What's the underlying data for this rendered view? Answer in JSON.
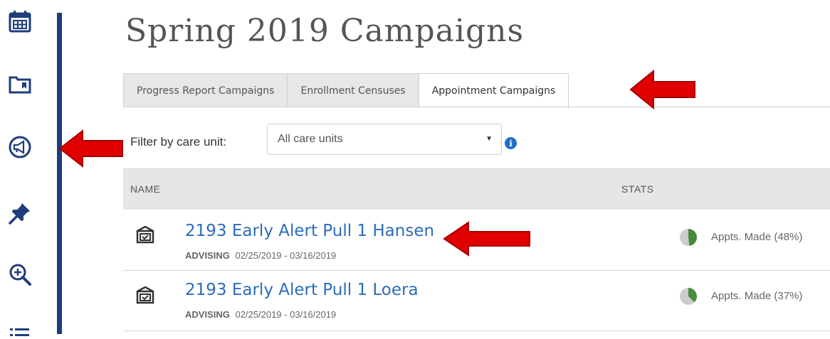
{
  "page": {
    "title": "Spring 2019 Campaigns"
  },
  "tabs": [
    {
      "label": "Progress Report Campaigns",
      "active": false
    },
    {
      "label": "Enrollment Censuses",
      "active": false
    },
    {
      "label": "Appointment Campaigns",
      "active": true
    }
  ],
  "filter": {
    "label": "Filter by care unit:",
    "selected": "All care units"
  },
  "table": {
    "columns": [
      "NAME",
      "STATS"
    ],
    "rows": [
      {
        "name": "2193 Early Alert Pull 1 Hansen",
        "category": "ADVISING",
        "dates": "02/25/2019 - 03/16/2019",
        "stat_label": "Appts. Made (48%)",
        "stat_value": 48
      },
      {
        "name": "2193 Early Alert Pull 1 Loera",
        "category": "ADVISING",
        "dates": "02/25/2019 - 03/16/2019",
        "stat_label": "Appts. Made (37%)",
        "stat_value": 37
      }
    ]
  },
  "colors": {
    "rail_divider": "#1f3d7a",
    "link": "#2c6cb8",
    "pie_fill": "#4a8a3c",
    "pie_empty": "#cccccc",
    "arrow": "#e00000"
  },
  "icons": {
    "rail": [
      "calendar-icon",
      "folder-icon",
      "megaphone-icon",
      "pin-icon",
      "zoom-in-icon",
      "list-icon"
    ],
    "row": "campaign-box-icon"
  }
}
